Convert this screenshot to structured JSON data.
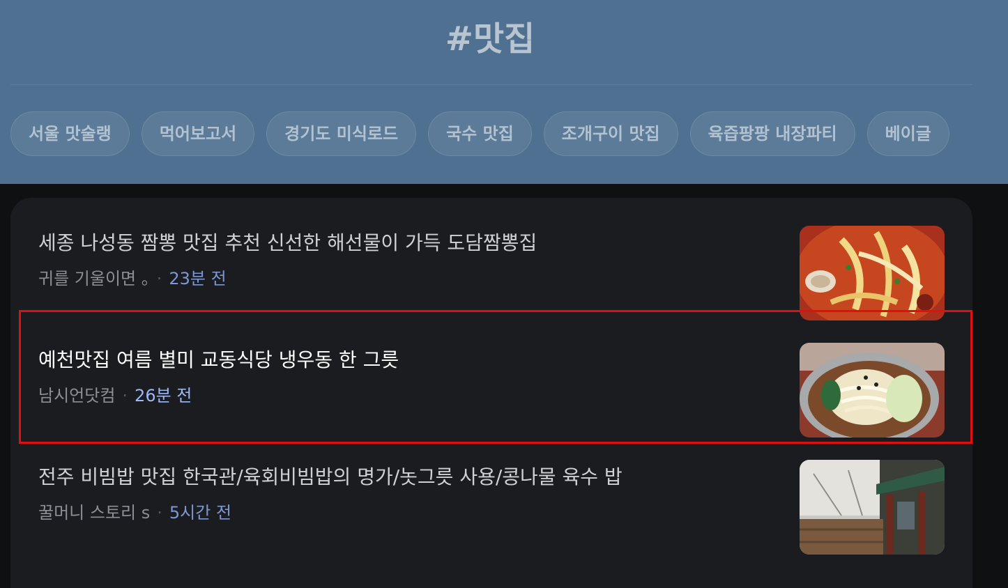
{
  "page": {
    "title": "#맛집"
  },
  "chips": [
    "서울 맛술랭",
    "먹어보고서",
    "경기도 미식로드",
    "국수 맛집",
    "조개구이 맛집",
    "육즙팡팡 내장파티",
    "베이글"
  ],
  "articles": [
    {
      "title": "세종 나성동 짬뽕 맛집 추천 신선한 해선물이 가득 도담짬뽕집",
      "source": "귀를 기울이면 。",
      "time": "23분 전",
      "thumbnail_icon": "jjamppong-photo"
    },
    {
      "title": "예천맛집 여름 별미 교동식당 냉우동 한 그릇",
      "source": "남시언닷컴",
      "time": "26분 전",
      "thumbnail_icon": "cold-udon-photo"
    },
    {
      "title": "전주 비빔밥 맛집 한국관/육회비빔밥의 명가/놋그릇 사용/콩나물 육수 밥",
      "source": "꿀머니 스토리 s",
      "time": "5시간 전",
      "thumbnail_icon": "restaurant-exterior-photo"
    }
  ],
  "colors": {
    "header_bg": "#4f7090",
    "panel_bg": "#1b1c20",
    "time_text": "#7d96d4",
    "highlight": "#e01010"
  }
}
